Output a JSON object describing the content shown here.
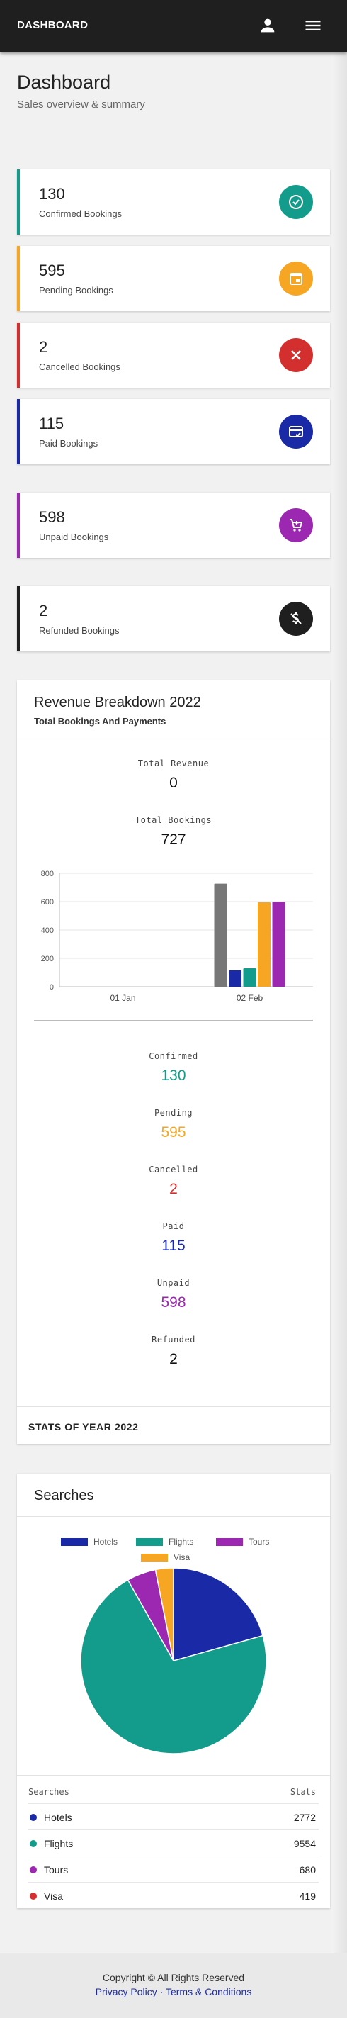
{
  "topbar": {
    "brand": "DASHBOARD"
  },
  "header": {
    "title": "Dashboard",
    "subtitle": "Sales overview & summary"
  },
  "stats": [
    {
      "value": "130",
      "label": "Confirmed Bookings",
      "color": "#139c8b",
      "icon": "check-circle-icon"
    },
    {
      "value": "595",
      "label": "Pending Bookings",
      "color": "#f6a623",
      "icon": "calendar-icon"
    },
    {
      "value": "2",
      "label": "Cancelled Bookings",
      "color": "#d32f2f",
      "icon": "close-icon"
    },
    {
      "value": "115",
      "label": "Paid Bookings",
      "color": "#1a2aa6",
      "icon": "credit-card-icon"
    },
    {
      "value": "598",
      "label": "Unpaid Bookings",
      "color": "#9c27b0",
      "icon": "cart-icon"
    },
    {
      "value": "2",
      "label": "Refunded Bookings",
      "color": "#1f1f1f",
      "icon": "money-off-icon"
    }
  ],
  "revenue": {
    "title": "Revenue Breakdown 2022",
    "subtitle": "Total Bookings And Payments",
    "total_revenue_label": "Total Revenue",
    "total_revenue_value": "0",
    "total_bookings_label": "Total Bookings",
    "total_bookings_value": "727",
    "breakdown": [
      {
        "label": "Confirmed",
        "value": "130",
        "color": "#139c8b"
      },
      {
        "label": "Pending",
        "value": "595",
        "color": "#f6a623"
      },
      {
        "label": "Cancelled",
        "value": "2",
        "color": "#d32f2f"
      },
      {
        "label": "Paid",
        "value": "115",
        "color": "#1a2aa6"
      },
      {
        "label": "Unpaid",
        "value": "598",
        "color": "#9c27b0"
      },
      {
        "label": "Refunded",
        "value": "2",
        "color": "#111111"
      }
    ],
    "footer": "STATS OF YEAR 2022"
  },
  "chart_data": [
    {
      "type": "bar",
      "categories": [
        "01 Jan",
        "02 Feb"
      ],
      "ylim": [
        0,
        800
      ],
      "yticks": [
        "0",
        "200",
        "400",
        "600",
        "800"
      ],
      "grid": true,
      "series": [
        {
          "values": [
            0,
            727
          ],
          "color": "#777777"
        },
        {
          "values": [
            0,
            115
          ],
          "color": "#1a2aa6"
        },
        {
          "values": [
            0,
            130
          ],
          "color": "#139c8b"
        },
        {
          "values": [
            0,
            595
          ],
          "color": "#f6a623"
        },
        {
          "values": [
            0,
            598
          ],
          "color": "#9c27b0"
        }
      ]
    },
    {
      "type": "pie",
      "legend_placement": "top",
      "slices": [
        {
          "name": "Hotels",
          "value": 2772,
          "color": "#1a2aa6"
        },
        {
          "name": "Flights",
          "value": 9554,
          "color": "#139c8b"
        },
        {
          "name": "Tours",
          "value": 680,
          "color": "#9c27b0"
        },
        {
          "name": "Visa",
          "value": 419,
          "color": "#f6a623"
        }
      ]
    }
  ],
  "searches": {
    "title": "Searches",
    "col_searches": "Searches",
    "col_stats": "Stats",
    "rows": [
      {
        "name": "Hotels",
        "value": "2772",
        "color": "#1a2aa6"
      },
      {
        "name": "Flights",
        "value": "9554",
        "color": "#139c8b"
      },
      {
        "name": "Tours",
        "value": "680",
        "color": "#9c27b0"
      },
      {
        "name": "Visa",
        "value": "419",
        "color": "#d32f2f"
      }
    ]
  },
  "footer": {
    "copyright": "Copyright © All Rights Reserved",
    "privacy": "Privacy Policy",
    "separator": "·",
    "terms": "Terms & Conditions"
  }
}
